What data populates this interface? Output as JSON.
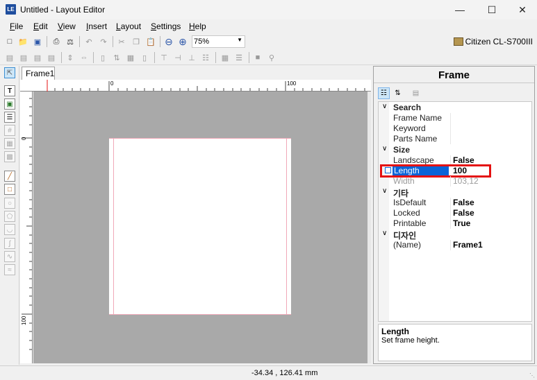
{
  "window": {
    "title": "Untitled - Layout Editor",
    "app_icon_text": "LE"
  },
  "menu": {
    "items": [
      {
        "label": "File",
        "accel": "F",
        "rest": "ile"
      },
      {
        "label": "Edit",
        "accel": "E",
        "rest": "dit"
      },
      {
        "label": "View",
        "accel": "V",
        "rest": "iew"
      },
      {
        "label": "Insert",
        "accel": "I",
        "rest": "nsert"
      },
      {
        "label": "Layout",
        "accel": "L",
        "rest": "ayout"
      },
      {
        "label": "Settings",
        "accel": "S",
        "rest": "ettings"
      },
      {
        "label": "Help",
        "accel": "H",
        "rest": "elp"
      }
    ]
  },
  "toolbar": {
    "zoom_value": "75%",
    "printer": "Citizen CL-S700III"
  },
  "editor": {
    "tab_label": "Frame1",
    "ruler_labels": {
      "h0": "0",
      "h100": "100",
      "v0": "0",
      "v100": "100"
    }
  },
  "properties": {
    "title": "Frame",
    "categories": [
      {
        "name": "Search",
        "props": [
          {
            "name": "Frame Name",
            "value": ""
          },
          {
            "name": "Keyword",
            "value": ""
          },
          {
            "name": "Parts Name",
            "value": ""
          }
        ]
      },
      {
        "name": "Size",
        "props": [
          {
            "name": "Landscape",
            "value": "False"
          },
          {
            "name": "Length",
            "value": "100",
            "selected": true
          },
          {
            "name": "Width",
            "value": "103,12",
            "dim": true
          }
        ]
      },
      {
        "name": "기타",
        "props": [
          {
            "name": "IsDefault",
            "value": "False"
          },
          {
            "name": "Locked",
            "value": "False"
          },
          {
            "name": "Printable",
            "value": "True"
          }
        ]
      },
      {
        "name": "디자인",
        "props": [
          {
            "name": "(Name)",
            "value": "Frame1"
          }
        ]
      }
    ],
    "description": {
      "title": "Length",
      "text": "Set frame height."
    }
  },
  "status": {
    "coords": "-34.34 , 126.41 mm"
  },
  "colors": {
    "selection_blue": "#0a64d8",
    "highlight_red": "#e41111",
    "canvas_gray": "#a9a9a9",
    "margin_pink": "#f0a8b8"
  }
}
